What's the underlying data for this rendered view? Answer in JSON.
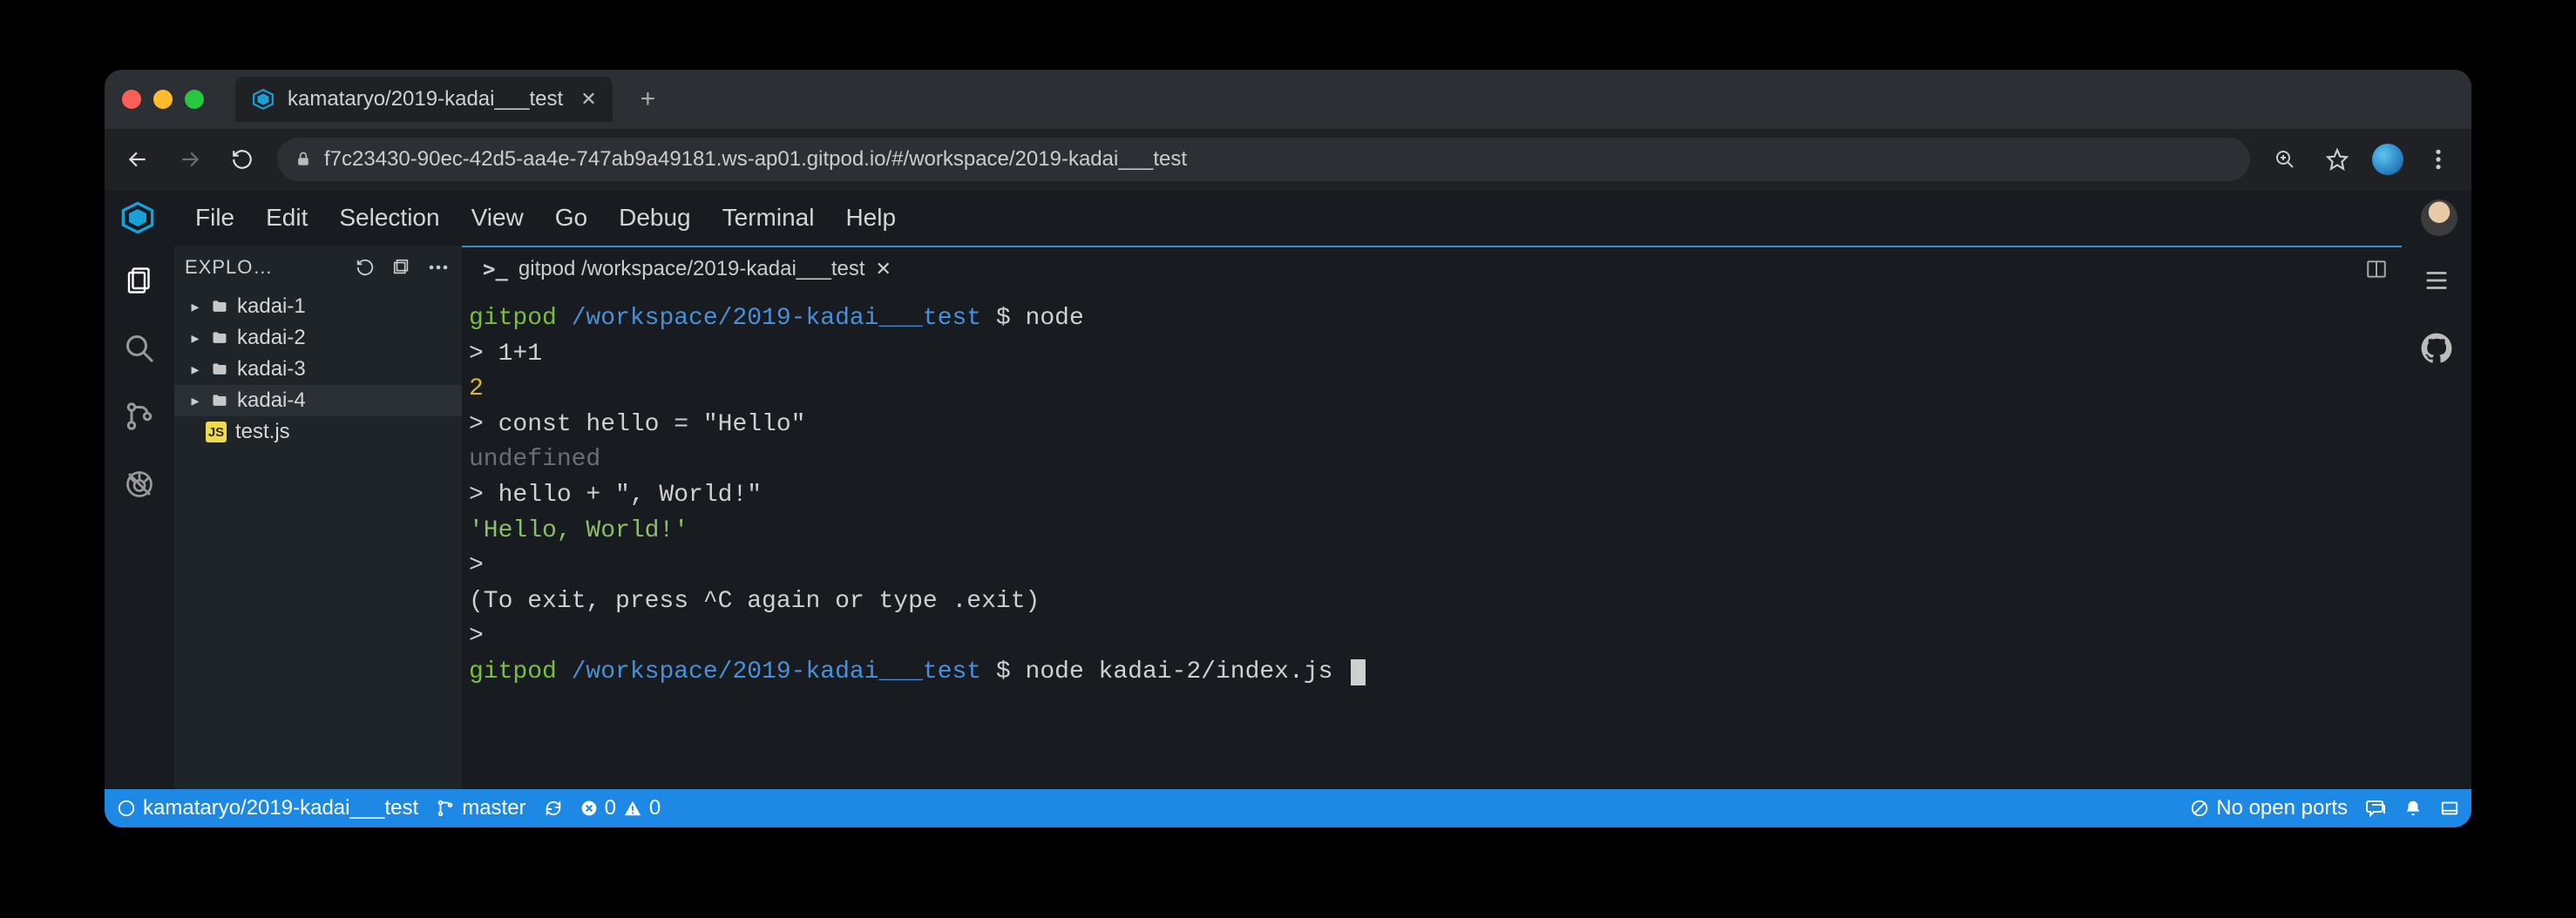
{
  "browser": {
    "tab_title": "kamataryo/2019-kadai___test",
    "url": "f7c23430-90ec-42d5-aa4e-747ab9a49181.ws-ap01.gitpod.io/#/workspace/2019-kadai___test"
  },
  "menubar": [
    "File",
    "Edit",
    "Selection",
    "View",
    "Go",
    "Debug",
    "Terminal",
    "Help"
  ],
  "sidebar": {
    "title": "EXPLO…",
    "tree": [
      {
        "type": "folder",
        "label": "kadai-1",
        "selected": false
      },
      {
        "type": "folder",
        "label": "kadai-2",
        "selected": false
      },
      {
        "type": "folder",
        "label": "kadai-3",
        "selected": false
      },
      {
        "type": "folder",
        "label": "kadai-4",
        "selected": true
      },
      {
        "type": "file-js",
        "label": "test.js",
        "selected": false
      }
    ]
  },
  "editor_tab": {
    "icon": ">_",
    "label": "gitpod /workspace/2019-kadai___test"
  },
  "terminal": {
    "lines": [
      {
        "segments": [
          {
            "t": "gitpod ",
            "c": "c-green"
          },
          {
            "t": "/workspace/2019-kadai___test",
            "c": "c-blue"
          },
          {
            "t": " $ ",
            "c": ""
          },
          {
            "t": "node",
            "c": ""
          }
        ]
      },
      {
        "segments": [
          {
            "t": "> 1+1",
            "c": ""
          }
        ]
      },
      {
        "segments": [
          {
            "t": "2",
            "c": "c-yellow"
          }
        ]
      },
      {
        "segments": [
          {
            "t": "> const hello = \"Hello\"",
            "c": ""
          }
        ]
      },
      {
        "segments": [
          {
            "t": "undefined",
            "c": "c-dim"
          }
        ]
      },
      {
        "segments": [
          {
            "t": "> hello + \", World!\"",
            "c": ""
          }
        ]
      },
      {
        "segments": [
          {
            "t": "'Hello, World!'",
            "c": "c-lgreen"
          }
        ]
      },
      {
        "segments": [
          {
            "t": ">",
            "c": ""
          }
        ]
      },
      {
        "segments": [
          {
            "t": "(To exit, press ^C again or type .exit)",
            "c": ""
          }
        ]
      },
      {
        "segments": [
          {
            "t": ">",
            "c": ""
          }
        ]
      },
      {
        "segments": [
          {
            "t": "gitpod ",
            "c": "c-green"
          },
          {
            "t": "/workspace/2019-kadai___test",
            "c": "c-blue"
          },
          {
            "t": " $ ",
            "c": ""
          },
          {
            "t": "node kadai-2/index.js ",
            "c": ""
          }
        ],
        "cursor": true
      }
    ]
  },
  "statusbar": {
    "repo": "kamataryo/2019-kadai___test",
    "branch": "master",
    "errors": "0",
    "warnings": "0",
    "ports": "No open ports"
  }
}
